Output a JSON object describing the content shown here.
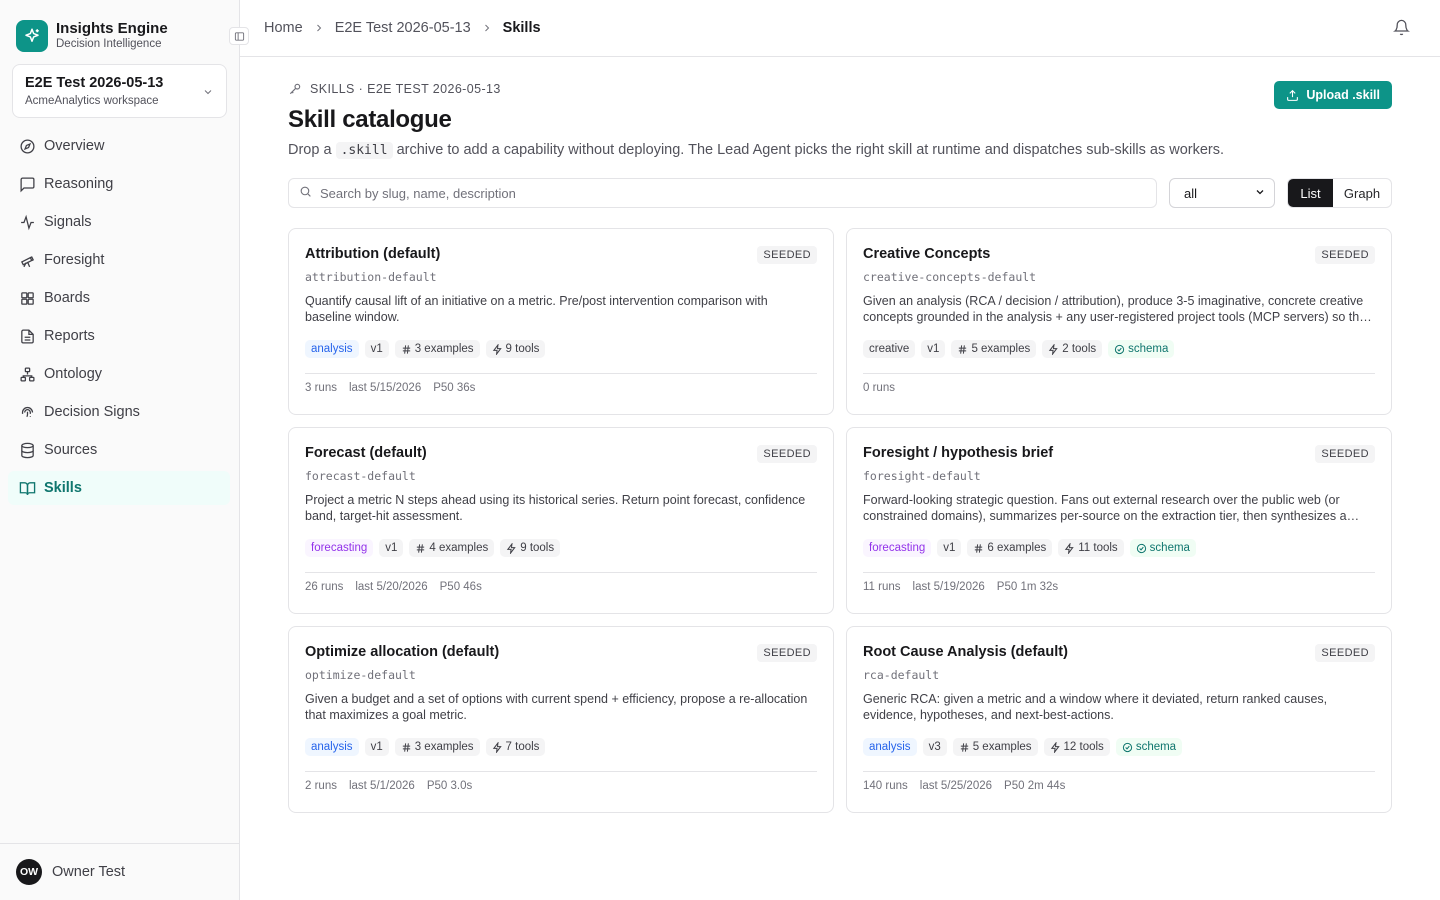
{
  "brand": {
    "name": "Insights Engine",
    "subtitle": "Decision Intelligence"
  },
  "workspace": {
    "title": "E2E Test 2026-05-13",
    "subtitle": "AcmeAnalytics workspace"
  },
  "nav": [
    {
      "label": "Overview",
      "icon": "compass-icon"
    },
    {
      "label": "Reasoning",
      "icon": "message-square-icon"
    },
    {
      "label": "Signals",
      "icon": "activity-icon"
    },
    {
      "label": "Foresight",
      "icon": "telescope-icon"
    },
    {
      "label": "Boards",
      "icon": "grid-icon"
    },
    {
      "label": "Reports",
      "icon": "file-text-icon"
    },
    {
      "label": "Ontology",
      "icon": "network-icon"
    },
    {
      "label": "Decision Signs",
      "icon": "fingerprint-icon"
    },
    {
      "label": "Sources",
      "icon": "database-icon"
    },
    {
      "label": "Skills",
      "icon": "book-open-icon"
    }
  ],
  "user": {
    "initials": "OW",
    "name": "Owner Test"
  },
  "breadcrumb": {
    "home": "Home",
    "project": "E2E Test 2026-05-13",
    "current": "Skills"
  },
  "page": {
    "eyebrow": "SKILLS · E2E TEST 2026-05-13",
    "title": "Skill catalogue",
    "desc_before": "Drop a",
    "desc_code": ".skill",
    "desc_after": "archive to add a capability without deploying. The Lead Agent picks the right skill at runtime and dispatches sub-skills as workers.",
    "upload_label": "Upload .skill"
  },
  "filters": {
    "search_placeholder": "Search by slug, name, description",
    "category_value": "all",
    "view_list": "List",
    "view_graph": "Graph"
  },
  "colors": {
    "accent": "#0d9488",
    "active_nav_bg": "#f0fdfa"
  },
  "cards": [
    {
      "title": "Attribution (default)",
      "badge": "SEEDED",
      "slug": "attribution-default",
      "desc": "Quantify causal lift of an initiative on a metric. Pre/post intervention comparison with baseline window.",
      "category": "analysis",
      "version": "v1",
      "examples": "3 examples",
      "tools": "9 tools",
      "schema": "",
      "runs": "3 runs",
      "last": "last 5/15/2026",
      "p50": "P50 36s"
    },
    {
      "title": "Creative Concepts",
      "badge": "SEEDED",
      "slug": "creative-concepts-default",
      "desc": "Given an analysis (RCA / decision / attribution), produce 3-5 imaginative, concrete creative concepts grounded in the analysis + any user-registered project tools (MCP servers) so the output can be acted on.",
      "category": "creative",
      "version": "v1",
      "examples": "5 examples",
      "tools": "2 tools",
      "schema": "schema",
      "runs": "0 runs",
      "last": "",
      "p50": ""
    },
    {
      "title": "Forecast (default)",
      "badge": "SEEDED",
      "slug": "forecast-default",
      "desc": "Project a metric N steps ahead using its historical series. Return point forecast, confidence band, target-hit assessment.",
      "category": "forecasting",
      "version": "v1",
      "examples": "4 examples",
      "tools": "9 tools",
      "schema": "",
      "runs": "26 runs",
      "last": "last 5/20/2026",
      "p50": "P50 46s"
    },
    {
      "title": "Foresight / hypothesis brief",
      "badge": "SEEDED",
      "slug": "foresight-default",
      "desc": "Forward-looking strategic question. Fans out external research over the public web (or constrained domains), summarizes per-source on the extraction tier, then synthesizes a hypothesis brief.",
      "category": "forecasting",
      "version": "v1",
      "examples": "6 examples",
      "tools": "11 tools",
      "schema": "schema",
      "runs": "11 runs",
      "last": "last 5/19/2026",
      "p50": "P50 1m 32s"
    },
    {
      "title": "Optimize allocation (default)",
      "badge": "SEEDED",
      "slug": "optimize-default",
      "desc": "Given a budget and a set of options with current spend + efficiency, propose a re-allocation that maximizes a goal metric.",
      "category": "analysis",
      "version": "v1",
      "examples": "3 examples",
      "tools": "7 tools",
      "schema": "",
      "runs": "2 runs",
      "last": "last 5/1/2026",
      "p50": "P50 3.0s"
    },
    {
      "title": "Root Cause Analysis (default)",
      "badge": "SEEDED",
      "slug": "rca-default",
      "desc": "Generic RCA: given a metric and a window where it deviated, return ranked causes, evidence, hypotheses, and next-best-actions.",
      "category": "analysis",
      "version": "v3",
      "examples": "5 examples",
      "tools": "12 tools",
      "schema": "schema",
      "runs": "140 runs",
      "last": "last 5/25/2026",
      "p50": "P50 2m 44s"
    }
  ]
}
